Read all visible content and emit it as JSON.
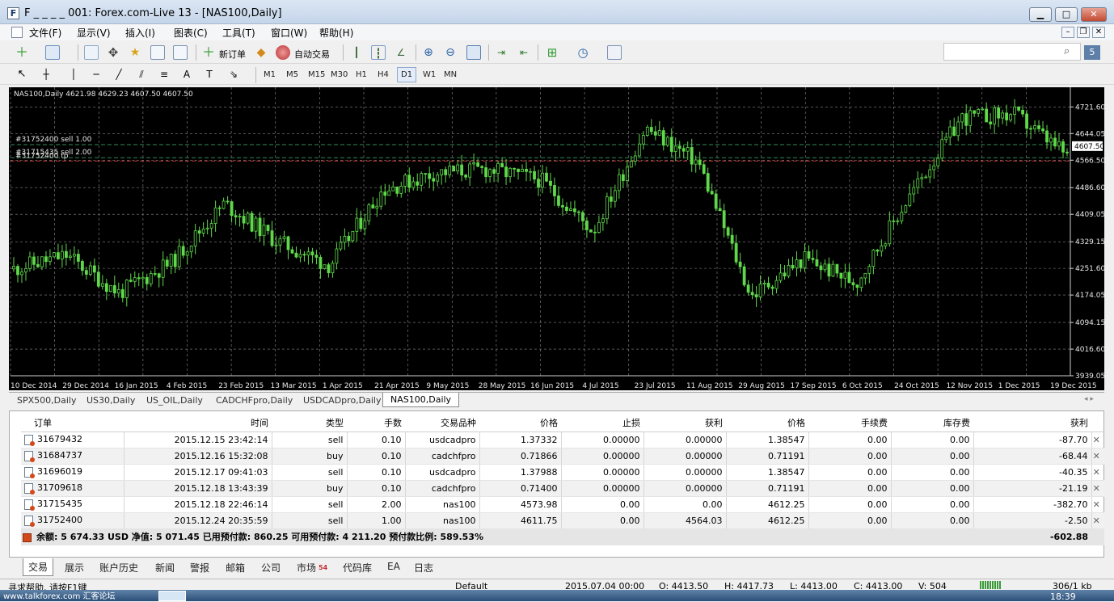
{
  "window": {
    "title": "F _ _ _ _ 001: Forex.com-Live 13 - [NAS100,Daily]",
    "logo_letter": "F",
    "minimize": "▁",
    "maximize": "□",
    "close": "✕"
  },
  "menu": [
    "文件(F)",
    "显示(V)",
    "插入(I)",
    "图表(C)",
    "工具(T)",
    "窗口(W)",
    "帮助(H)"
  ],
  "mdi": {
    "minimize": "–",
    "restore": "❐",
    "close": "✕"
  },
  "toolbar": {
    "new_order": "新订单",
    "auto_trade": "自动交易",
    "search_placeholder": ""
  },
  "timeframes": [
    "M1",
    "M5",
    "M15",
    "M30",
    "H1",
    "H4",
    "D1",
    "W1",
    "MN"
  ],
  "active_timeframe": "D1",
  "chart": {
    "info": "NAS100,Daily  4621.98 4629.23 4607.50 4607.50",
    "order_lines": [
      {
        "label": "#31752400 sell 1.00",
        "price": 4611.75,
        "color": "#2e8b57"
      },
      {
        "label": "#31715435 sell 2.00",
        "price": 4573.98,
        "color": "#2e8b57"
      },
      {
        "label": "#31752400 tp",
        "price": 4564.03,
        "color": "#c03030"
      }
    ],
    "current_price": "4607.50",
    "y_ticks": [
      "4721.60",
      "4644.05",
      "4566.50",
      "4486.60",
      "4409.05",
      "4329.15",
      "4251.60",
      "4174.05",
      "4094.15",
      "4016.60",
      "3939.05"
    ],
    "x_ticks": [
      "10 Dec 2014",
      "29 Dec 2014",
      "16 Jan 2015",
      "4 Feb 2015",
      "23 Feb 2015",
      "13 Mar 2015",
      "1 Apr 2015",
      "21 Apr 2015",
      "9 May 2015",
      "28 May 2015",
      "16 Jun 2015",
      "4 Jul 2015",
      "23 Jul 2015",
      "11 Aug 2015",
      "29 Aug 2015",
      "17 Sep 2015",
      "6 Oct 2015",
      "24 Oct 2015",
      "12 Nov 2015",
      "1 Dec 2015",
      "19 Dec 2015"
    ],
    "bull_color": "#5fd84a"
  },
  "chart_data": {
    "type": "line",
    "title": "NAS100,Daily",
    "x": [
      "10 Dec 2014",
      "29 Dec 2014",
      "16 Jan 2015",
      "4 Feb 2015",
      "23 Feb 2015",
      "13 Mar 2015",
      "1 Apr 2015",
      "21 Apr 2015",
      "9 May 2015",
      "28 May 2015",
      "16 Jun 2015",
      "4 Jul 2015",
      "23 Jul 2015",
      "11 Aug 2015",
      "29 Aug 2015",
      "17 Sep 2015",
      "6 Oct 2015",
      "24 Oct 2015",
      "12 Nov 2015",
      "1 Dec 2015",
      "19 Dec 2015"
    ],
    "series": [
      {
        "values": [
          4250,
          4290,
          4180,
          4270,
          4440,
          4330,
          4260,
          4480,
          4530,
          4540,
          4510,
          4360,
          4660,
          4560,
          4170,
          4280,
          4210,
          4460,
          4690,
          4700,
          4580
        ]
      }
    ],
    "ylim": [
      3939.05,
      4760
    ]
  },
  "symbol_tabs": [
    "SPX500,Daily",
    "US30,Daily",
    "US_OIL,Daily",
    "CADCHFpro,Daily",
    "USDCADpro,Daily",
    "NAS100,Daily"
  ],
  "active_symbol_tab": "NAS100,Daily",
  "orders": {
    "headers": [
      "订单",
      "时间",
      "类型",
      "手数",
      "交易品种",
      "价格",
      "止损",
      "获利",
      "价格",
      "手续费",
      "库存费",
      "获利"
    ],
    "rows": [
      [
        "31679432",
        "2015.12.15 23:42:14",
        "sell",
        "0.10",
        "usdcadpro",
        "1.37332",
        "0.00000",
        "0.00000",
        "1.38547",
        "0.00",
        "0.00",
        "-87.70"
      ],
      [
        "31684737",
        "2015.12.16 15:32:08",
        "buy",
        "0.10",
        "cadchfpro",
        "0.71866",
        "0.00000",
        "0.00000",
        "0.71191",
        "0.00",
        "0.00",
        "-68.44"
      ],
      [
        "31696019",
        "2015.12.17 09:41:03",
        "sell",
        "0.10",
        "usdcadpro",
        "1.37988",
        "0.00000",
        "0.00000",
        "1.38547",
        "0.00",
        "0.00",
        "-40.35"
      ],
      [
        "31709618",
        "2015.12.18 13:43:39",
        "buy",
        "0.10",
        "cadchfpro",
        "0.71400",
        "0.00000",
        "0.00000",
        "0.71191",
        "0.00",
        "0.00",
        "-21.19"
      ],
      [
        "31715435",
        "2015.12.18 22:46:14",
        "sell",
        "2.00",
        "nas100",
        "4573.98",
        "0.00",
        "0.00",
        "4612.25",
        "0.00",
        "0.00",
        "-382.70"
      ],
      [
        "31752400",
        "2015.12.24 20:35:59",
        "sell",
        "1.00",
        "nas100",
        "4611.75",
        "0.00",
        "4564.03",
        "4612.25",
        "0.00",
        "0.00",
        "-2.50"
      ]
    ],
    "summary": "余额: 5 674.33 USD  净值: 5 071.45  已用预付款: 860.25  可用预付款: 4 211.20  预付款比例: 589.53%",
    "total": "-602.88",
    "close_glyph": "✕"
  },
  "bottom_tabs": [
    "交易",
    "展示",
    "账户历史",
    "新闻",
    "警报",
    "邮箱",
    "公司",
    "市场",
    "代码库",
    "EA",
    "日志"
  ],
  "market_badge": "54",
  "status": {
    "help": "寻求帮助, 请按F1键",
    "profile": "Default",
    "time": "2015.07.04 00:00",
    "open": "O: 4413.50",
    "high": "H: 4417.73",
    "low": "L: 4413.00",
    "close": "C: 4413.00",
    "volume": "V: 504",
    "traffic": "306/1 kb"
  },
  "taskbar": {
    "watermark": "www.talkforex.com 汇客论坛",
    "clock": "18:39"
  }
}
